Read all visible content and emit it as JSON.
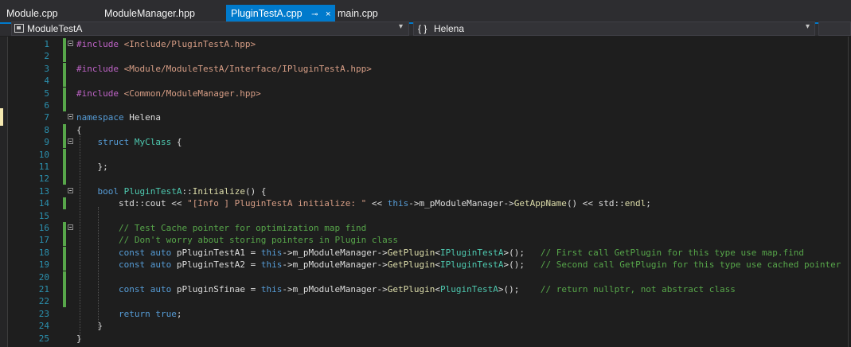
{
  "tabs": [
    {
      "label": "Module.cpp",
      "active": false
    },
    {
      "label": "ModuleManager.hpp",
      "active": false
    },
    {
      "label": "PluginTestA.cpp",
      "active": true
    },
    {
      "label": "main.cpp",
      "active": false
    }
  ],
  "active_tab_pin_icon": "⊸",
  "active_tab_close_icon": "×",
  "navbar": {
    "project": "ModuleTestA",
    "scope": "Helena",
    "scope_icon": "{ }"
  },
  "colors": {
    "accent": "#007acc",
    "editor_bg": "#1e1e1e",
    "line_number": "#2b91af",
    "change_marker": "#57a64a",
    "keyword": "#569cd6",
    "string": "#d69d85",
    "comment": "#57a64a",
    "type": "#4ec9b0"
  },
  "code_lines": [
    {
      "n": "1",
      "tokens": [
        [
          "mac",
          "#include "
        ],
        [
          "str",
          "<Include/PluginTestA.hpp>"
        ]
      ]
    },
    {
      "n": "2",
      "tokens": []
    },
    {
      "n": "3",
      "tokens": [
        [
          "mac",
          "#include "
        ],
        [
          "str",
          "<Module/ModuleTestA/Interface/IPluginTestA.hpp>"
        ]
      ]
    },
    {
      "n": "4",
      "tokens": []
    },
    {
      "n": "5",
      "tokens": [
        [
          "mac",
          "#include "
        ],
        [
          "str",
          "<Common/ModuleManager.hpp>"
        ]
      ]
    },
    {
      "n": "6",
      "tokens": []
    },
    {
      "n": "7",
      "tokens": [
        [
          "kw",
          "namespace"
        ],
        [
          "pl",
          " Helena"
        ]
      ]
    },
    {
      "n": "8",
      "tokens": [
        [
          "pl",
          "{"
        ]
      ]
    },
    {
      "n": "9",
      "tokens": [
        [
          "pl",
          "    "
        ],
        [
          "kw",
          "struct"
        ],
        [
          "pl",
          " "
        ],
        [
          "ty",
          "MyClass"
        ],
        [
          "pl",
          " {"
        ]
      ]
    },
    {
      "n": "10",
      "tokens": []
    },
    {
      "n": "11",
      "tokens": [
        [
          "pl",
          "    };"
        ]
      ]
    },
    {
      "n": "12",
      "tokens": []
    },
    {
      "n": "13",
      "tokens": [
        [
          "pl",
          "    "
        ],
        [
          "kw",
          "bool"
        ],
        [
          "pl",
          " "
        ],
        [
          "ty",
          "PluginTestA"
        ],
        [
          "pl",
          "::"
        ],
        [
          "fn",
          "Initialize"
        ],
        [
          "pl",
          "() {"
        ]
      ]
    },
    {
      "n": "14",
      "tokens": [
        [
          "pl",
          "        std::cout << "
        ],
        [
          "str",
          "\"[Info ] PluginTestA initialize: \""
        ],
        [
          "pl",
          " << "
        ],
        [
          "kw",
          "this"
        ],
        [
          "pl",
          "->m_pModuleManager->"
        ],
        [
          "fn",
          "GetAppName"
        ],
        [
          "pl",
          "() << std::"
        ],
        [
          "fn",
          "endl"
        ],
        [
          "pl",
          ";"
        ]
      ]
    },
    {
      "n": "15",
      "tokens": []
    },
    {
      "n": "16",
      "tokens": [
        [
          "pl",
          "        "
        ],
        [
          "cm",
          "// Test Cache pointer for optimization map find"
        ]
      ]
    },
    {
      "n": "17",
      "tokens": [
        [
          "pl",
          "        "
        ],
        [
          "cm",
          "// Don't worry about storing pointers in Plugin class"
        ]
      ]
    },
    {
      "n": "18",
      "tokens": [
        [
          "pl",
          "        "
        ],
        [
          "kw",
          "const"
        ],
        [
          "pl",
          " "
        ],
        [
          "kw",
          "auto"
        ],
        [
          "pl",
          " pPluginTestA1 = "
        ],
        [
          "kw",
          "this"
        ],
        [
          "pl",
          "->m_pModuleManager->"
        ],
        [
          "fn",
          "GetPlugin"
        ],
        [
          "pl",
          "<"
        ],
        [
          "ty",
          "IPluginTestA"
        ],
        [
          "pl",
          ">();   "
        ],
        [
          "cm",
          "// First call GetPlugin for this type use map.find"
        ]
      ]
    },
    {
      "n": "19",
      "tokens": [
        [
          "pl",
          "        "
        ],
        [
          "kw",
          "const"
        ],
        [
          "pl",
          " "
        ],
        [
          "kw",
          "auto"
        ],
        [
          "pl",
          " pPluginTestA2 = "
        ],
        [
          "kw",
          "this"
        ],
        [
          "pl",
          "->m_pModuleManager->"
        ],
        [
          "fn",
          "GetPlugin"
        ],
        [
          "pl",
          "<"
        ],
        [
          "ty",
          "IPluginTestA"
        ],
        [
          "pl",
          ">();   "
        ],
        [
          "cm",
          "// Second call GetPlugin for this type use cached pointer"
        ]
      ]
    },
    {
      "n": "20",
      "tokens": []
    },
    {
      "n": "21",
      "tokens": [
        [
          "pl",
          "        "
        ],
        [
          "kw",
          "const"
        ],
        [
          "pl",
          " "
        ],
        [
          "kw",
          "auto"
        ],
        [
          "pl",
          " pPluginSfinae = "
        ],
        [
          "kw",
          "this"
        ],
        [
          "pl",
          "->m_pModuleManager->"
        ],
        [
          "fn",
          "GetPlugin"
        ],
        [
          "pl",
          "<"
        ],
        [
          "ty",
          "PluginTestA"
        ],
        [
          "pl",
          ">();    "
        ],
        [
          "cm",
          "// return nullptr, not abstract class"
        ]
      ]
    },
    {
      "n": "22",
      "tokens": []
    },
    {
      "n": "23",
      "tokens": [
        [
          "pl",
          "        "
        ],
        [
          "kw",
          "return"
        ],
        [
          "pl",
          " "
        ],
        [
          "kw",
          "true"
        ],
        [
          "pl",
          ";"
        ]
      ]
    },
    {
      "n": "24",
      "tokens": [
        [
          "pl",
          "    }"
        ]
      ]
    },
    {
      "n": "25",
      "tokens": [
        [
          "pl",
          "}"
        ]
      ]
    }
  ]
}
